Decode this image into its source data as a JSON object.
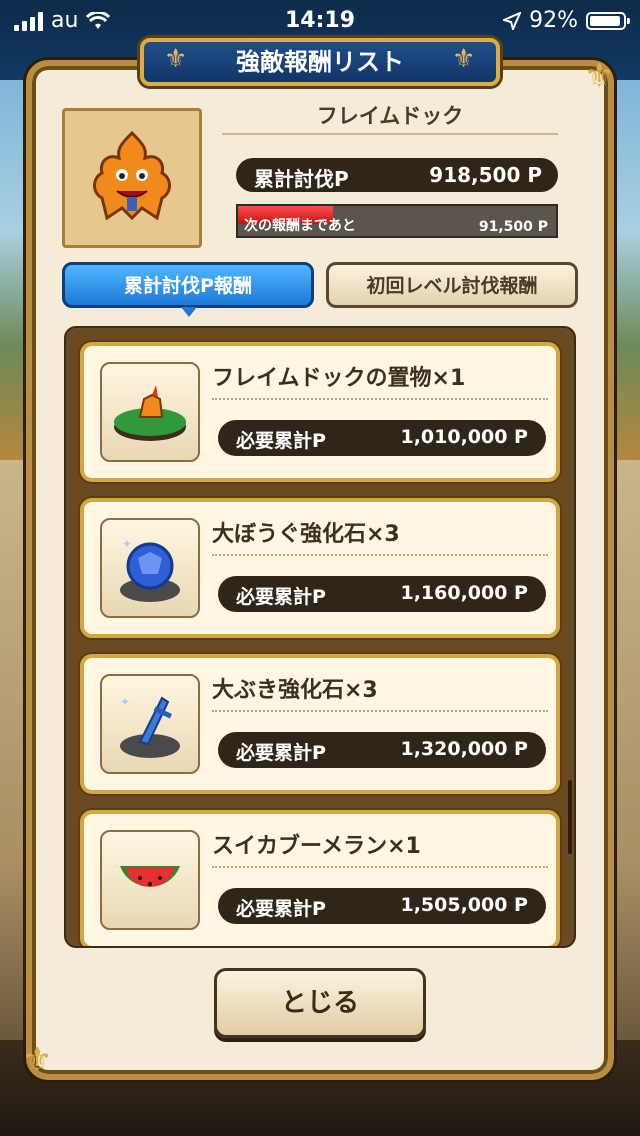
{
  "status_bar": {
    "carrier": "au",
    "time": "14:19",
    "battery": "92%"
  },
  "dialog": {
    "title": "強敵報酬リスト",
    "monster_name": "フレイムドック",
    "total_points_label": "累計討伐P",
    "total_points_value": "918,500 P",
    "next_reward_label": "次の報酬まであと",
    "next_reward_value": "91,500 P",
    "progress_fraction": 0.3,
    "tabs": [
      {
        "label": "累計討伐P報酬",
        "active": true
      },
      {
        "label": "初回レベル討伐報酬",
        "active": false
      }
    ],
    "rewards": [
      {
        "name": "フレイムドックの置物×1",
        "req_label": "必要累計P",
        "req_value": "1,010,000 P",
        "icon": "flame-dog-figurine-icon"
      },
      {
        "name": "大ぼうぐ強化石×3",
        "req_label": "必要累計P",
        "req_value": "1,160,000 P",
        "icon": "armor-upgrade-stone-icon"
      },
      {
        "name": "大ぶき強化石×3",
        "req_label": "必要累計P",
        "req_value": "1,320,000 P",
        "icon": "weapon-upgrade-stone-icon"
      },
      {
        "name": "スイカブーメラン×1",
        "req_label": "必要累計P",
        "req_value": "1,505,000 P",
        "icon": "watermelon-boomerang-icon"
      }
    ],
    "close_label": "とじる"
  },
  "colors": {
    "accent_blue": "#1c79d6",
    "gold": "#d2a845",
    "dark_pill": "#2f2519",
    "progress_red": "#c41515"
  }
}
